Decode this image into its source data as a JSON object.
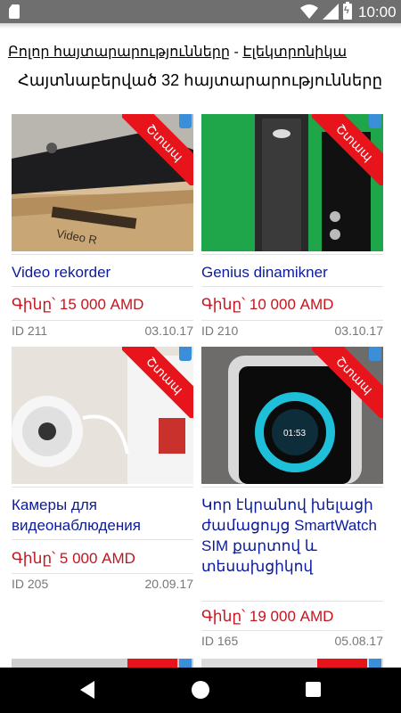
{
  "statusbar": {
    "time": "10:00",
    "battery_mark": "ϟ"
  },
  "breadcrumb": {
    "all": "Բոլոր հայտարարությունները",
    "separator": "-",
    "category": "Էլեկտրոնիկա"
  },
  "found_text": "Հայտնաբերված 32 հայտարարությունները",
  "ribbon_label": "Շտապ",
  "listings": [
    {
      "title": "Video rekorder",
      "price": "Գինը՝ 15 000 AMD",
      "id": "ID 211",
      "date": "03.10.17",
      "image": "video-recorder-photo"
    },
    {
      "title": "Genius dinamikner",
      "price": "Գինը՝ 10 000 AMD",
      "id": "ID 210",
      "date": "03.10.17",
      "image": "speaker-photo"
    },
    {
      "title": "Камеры для видеонаблюдения",
      "price": "Գինը՝ 5 000 AMD",
      "id": "ID 205",
      "date": "20.09.17",
      "image": "security-camera-photo"
    },
    {
      "title": "Կոր էկրանով խելացի ժամացույց SmartWatch SIM քարտով և տեսախցիկով",
      "price": "Գինը՝ 19 000 AMD",
      "id": "ID 165",
      "date": "05.08.17",
      "image": "smartwatch-photo"
    }
  ],
  "colors": {
    "title": "#0b1b9c",
    "price": "#c5141e",
    "ribbon": "#e8141c"
  }
}
